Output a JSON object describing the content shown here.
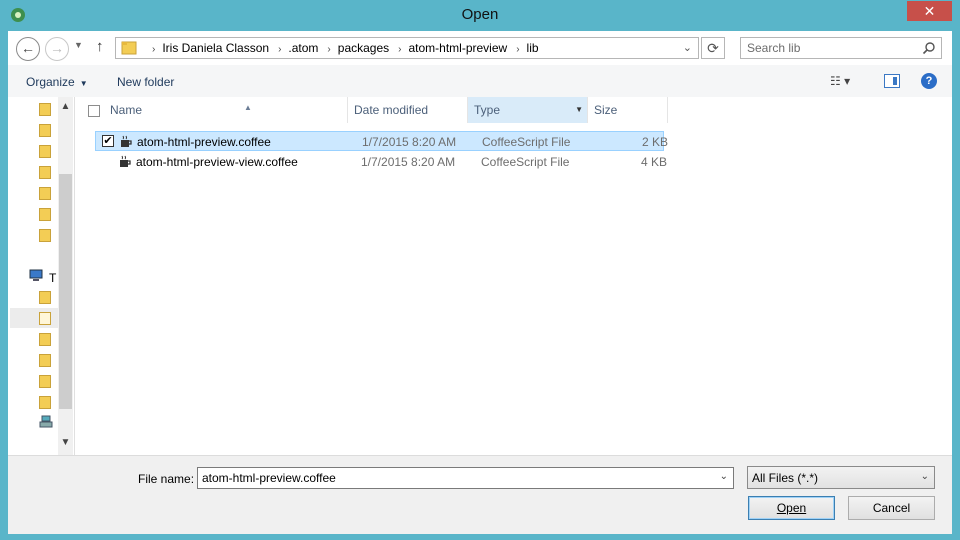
{
  "window": {
    "title": "Open",
    "close_glyph": "✕"
  },
  "address": {
    "breadcrumbs": [
      "Iris Daniela Classon",
      ".atom",
      "packages",
      "atom-html-preview",
      "lib"
    ],
    "separator": "›"
  },
  "search": {
    "placeholder": "Search lib"
  },
  "toolbar": {
    "organize_label": "Organize",
    "new_folder_label": "New folder"
  },
  "nav_pane": {
    "partial_label": "T"
  },
  "columns": {
    "name": "Name",
    "date_modified": "Date modified",
    "type": "Type",
    "size": "Size"
  },
  "files": [
    {
      "name": "atom-html-preview.coffee",
      "date": "1/7/2015 8:20 AM",
      "type": "CoffeeScript File",
      "size": "2 KB",
      "selected": true
    },
    {
      "name": "atom-html-preview-view.coffee",
      "date": "1/7/2015 8:20 AM",
      "type": "CoffeeScript File",
      "size": "4 KB",
      "selected": false
    }
  ],
  "bottom": {
    "file_name_label": "File name:",
    "file_name_value": "atom-html-preview.coffee",
    "filter_value": "All Files (*.*)",
    "open_label": "Open",
    "cancel_label": "Cancel"
  },
  "colors": {
    "titlebar": "#59b5c9",
    "close": "#c7504a",
    "selection": "#cce8ff",
    "link": "#1e395b"
  },
  "icons": [
    "app-icon",
    "back-icon",
    "forward-icon",
    "up-icon",
    "folder-icon",
    "refresh-icon",
    "search-icon",
    "view-icon",
    "preview-pane-icon",
    "help-icon",
    "computer-icon",
    "coffee-file-icon"
  ]
}
